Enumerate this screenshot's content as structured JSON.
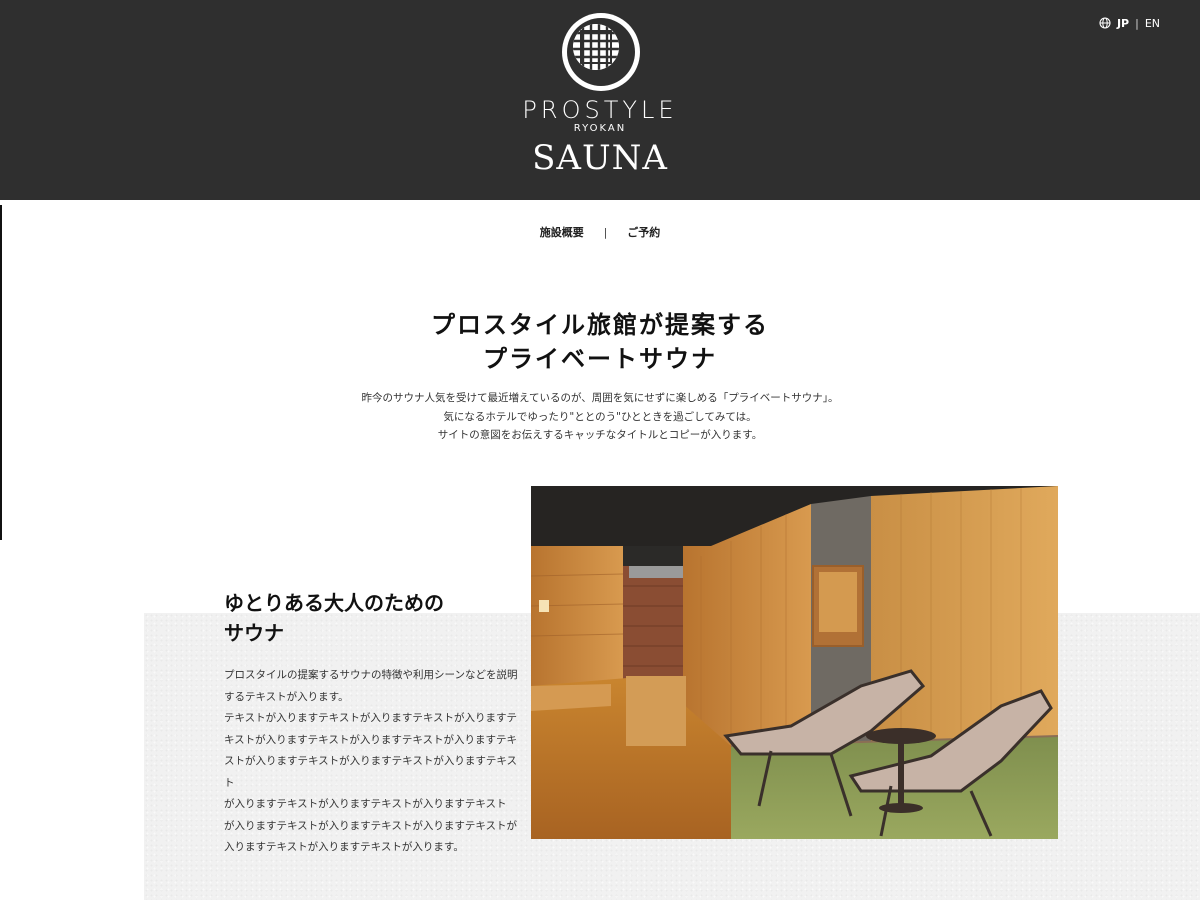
{
  "brand": {
    "name_line1": "PROSTYLE",
    "name_line2": "RYOKAN",
    "name_line3": "SAUNA",
    "header_bg": "#2f2f2f"
  },
  "language": {
    "icon": "globe-icon",
    "active": "JP",
    "separator": "|",
    "other": "EN"
  },
  "subnav": {
    "items": [
      {
        "label": "施設概要"
      },
      {
        "label": "ご予約"
      }
    ],
    "divider": "|"
  },
  "hero": {
    "title_line1": "プロスタイル旅館が提案する",
    "title_line2": "プライベートサウナ",
    "copy_line1": "昨今のサウナ人気を受けて最近増えているのが、周囲を気にせずに楽しめる「プライベートサウナ」。",
    "copy_line2": "気になるホテルでゆったり\"ととのう\"ひとときを過ごしてみては。",
    "copy_line3": "サイトの意図をお伝えするキャッチなタイトルとコピーが入ります。"
  },
  "feature": {
    "heading_line1": "ゆとりある大人のための",
    "heading_line2": "サウナ",
    "body_lines": [
      "プロスタイルの提案するサウナの特徴や利用シーンなどを説明",
      "するテキストが入ります。",
      "テキストが入りますテキストが入りますテキストが入りますテ",
      "キストが入りますテキストが入りますテキストが入りますテキ",
      "ストが入りますテキストが入りますテキストが入りますテキスト",
      "が入りますテキストが入りますテキストが入りますテキスト",
      "が入りますテキストが入りますテキストが入りますテキストが",
      "入りますテキストが入りますテキストが入ります。"
    ],
    "image": "sauna-lounge-photo"
  }
}
